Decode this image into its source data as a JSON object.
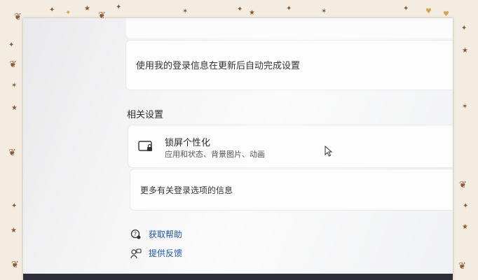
{
  "settings": {
    "autocomplete_label": "使用我的登录信息在更新后自动完成设置",
    "related_settings_title": "相关设置",
    "lock_screen": {
      "title": "锁屏个性化",
      "subtitle": "应用和状态、背景图片、动画",
      "icon": "lock-screen-icon"
    },
    "more_info_label": "更多有关登录选项的信息",
    "help_link": {
      "label": "获取帮助",
      "icon": "help-icon"
    },
    "feedback_link": {
      "label": "提供反馈",
      "icon": "feedback-icon"
    }
  },
  "colors": {
    "link": "#1b57b3",
    "frame_background": "#f3ece0",
    "frame_accent": "#8a5a2c"
  }
}
